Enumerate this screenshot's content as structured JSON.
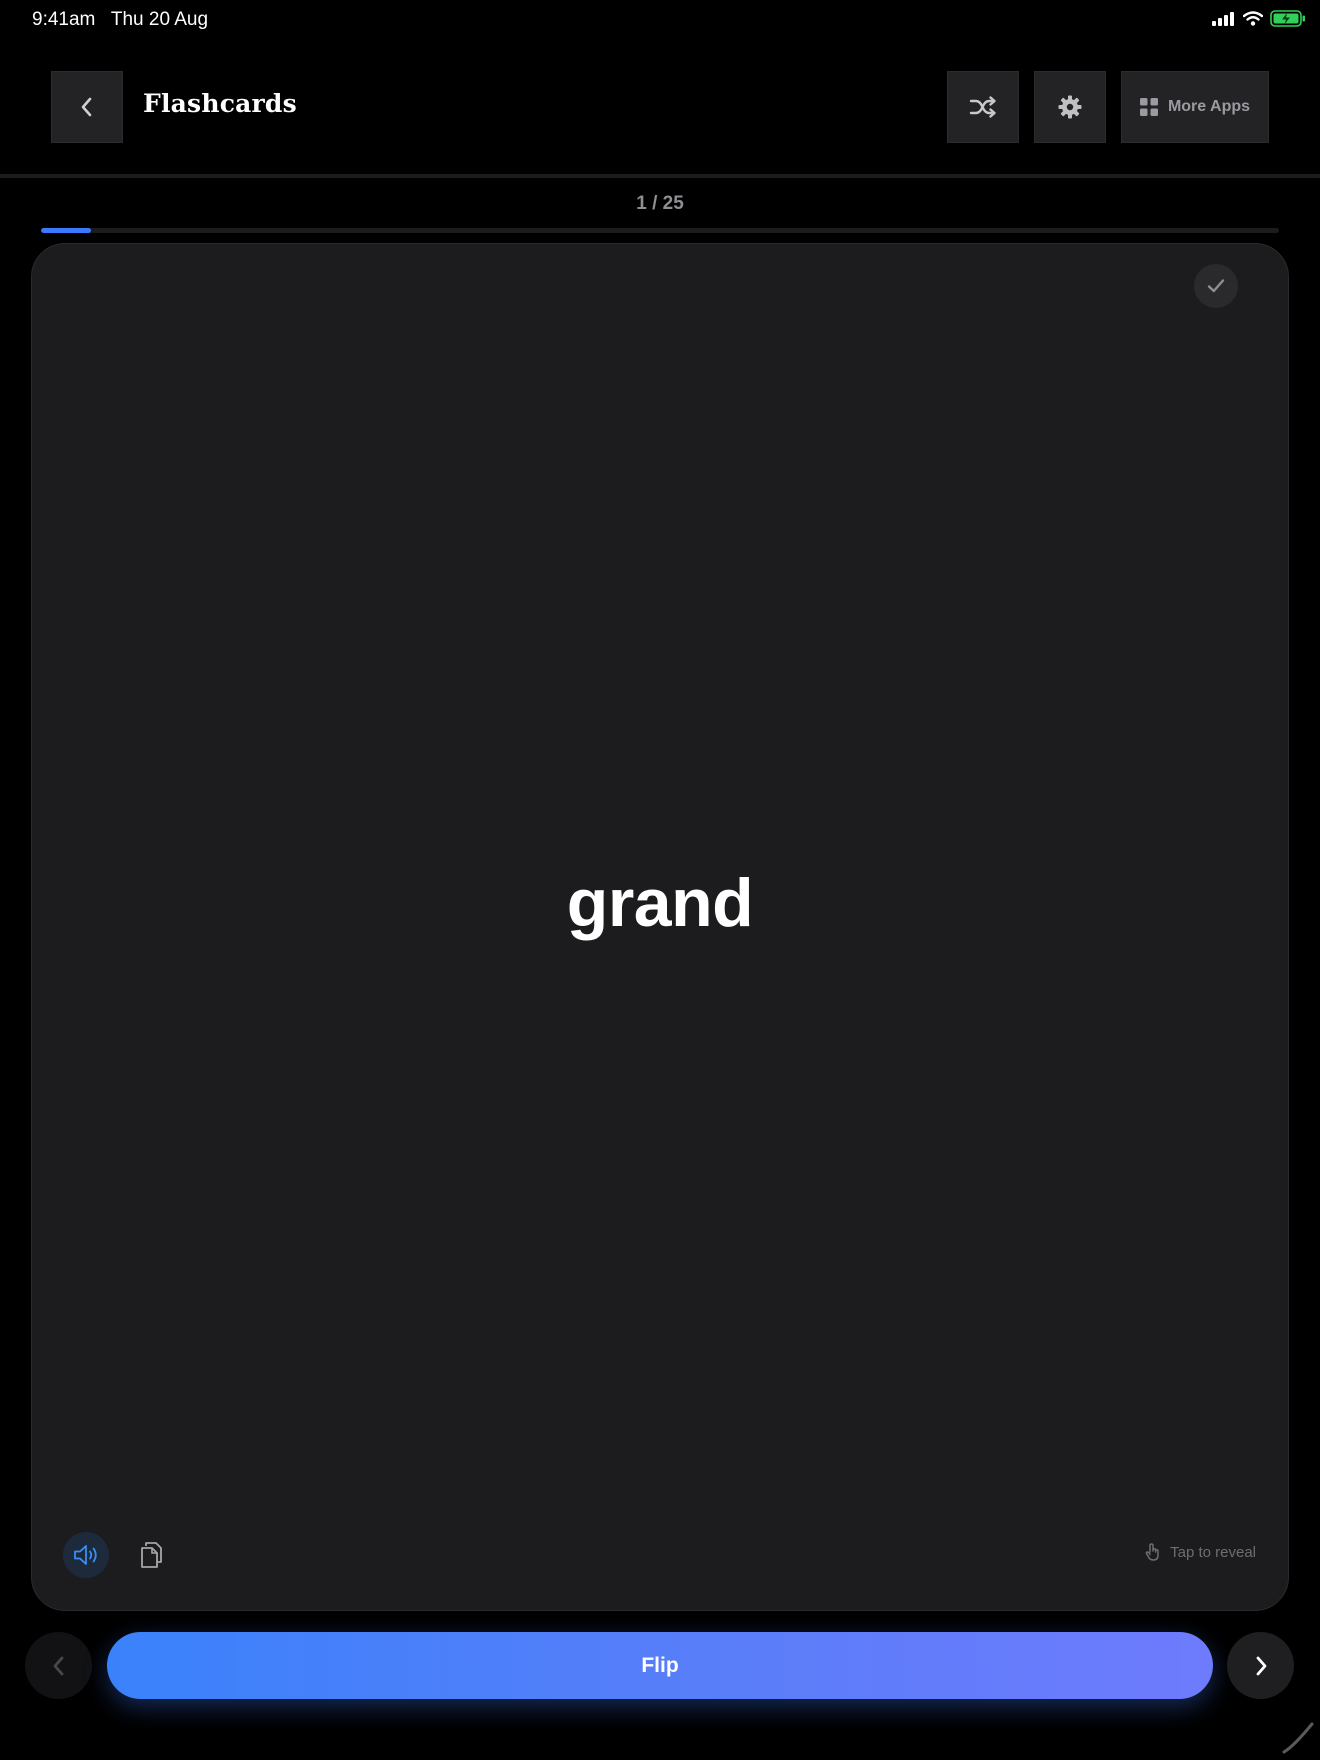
{
  "status_bar": {
    "time": "9:41am",
    "date": "Thu 20 Aug",
    "icons": [
      "cellular-signal-icon",
      "wifi-icon",
      "battery-charging-icon"
    ]
  },
  "header": {
    "back_icon": "chevron-left-icon",
    "title": "Flashcards",
    "shuffle_icon": "shuffle-icon",
    "settings_icon": "gear-icon",
    "more_apps_icon": "grid-icon",
    "more_apps_label": "More Apps"
  },
  "progress": {
    "label": "1 / 25",
    "current": 1,
    "total": 25,
    "fraction": 0.04
  },
  "card": {
    "word": "grand",
    "known_icon": "checkmark-icon",
    "speak_icon": "speaker-icon",
    "copy_icon": "copy-icon",
    "hint_icon": "tap-hand-icon",
    "hint_text": "Tap to reveal"
  },
  "navigation": {
    "prev_icon": "chevron-left-icon",
    "flip_label": "Flip",
    "next_icon": "chevron-right-icon"
  },
  "colors": {
    "background": "#000000",
    "card": "#1c1c1e",
    "accent": "#3a7afe",
    "flip_gradient_start": "#3a82fb",
    "flip_gradient_end": "#6e7bfd",
    "battery": "#30d158"
  }
}
